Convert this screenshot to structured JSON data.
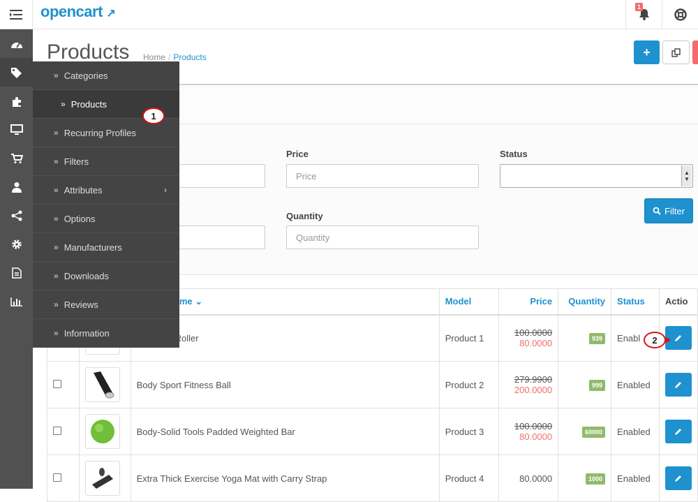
{
  "header": {
    "logo": "opencart",
    "logo_cart": "↗",
    "notification_count": "1"
  },
  "sidebar_icons": [
    "dashboard-icon",
    "tags-icon",
    "puzzle-icon",
    "desktop-icon",
    "cart-icon",
    "user-icon",
    "share-icon",
    "cog-icon",
    "report-icon",
    "chart-icon"
  ],
  "submenu": {
    "items": [
      {
        "label": "Categories"
      },
      {
        "label": "Products"
      },
      {
        "label": "Recurring Profiles"
      },
      {
        "label": "Filters"
      },
      {
        "label": "Attributes"
      },
      {
        "label": "Options"
      },
      {
        "label": "Manufacturers"
      },
      {
        "label": "Downloads"
      },
      {
        "label": "Reviews"
      },
      {
        "label": "Information"
      }
    ]
  },
  "page": {
    "title": "Products"
  },
  "breadcrumb": {
    "home": "Home",
    "sep": "/",
    "current": "Products"
  },
  "filter": {
    "price_label": "Price",
    "price_placeholder": "Price",
    "status_label": "Status",
    "quantity_label": "Quantity",
    "quantity_placeholder": "Quantity",
    "filter_button": "Filter"
  },
  "table": {
    "headers": {
      "name": "ame",
      "model": "Model",
      "price": "Price",
      "quantity": "Quantity",
      "status": "Status",
      "action": "Actio"
    },
    "rows": [
      {
        "name": "Roller",
        "model": "Product 1",
        "old_price": "100.0000",
        "special": "80.0000",
        "quantity": "939",
        "status": "Enabl"
      },
      {
        "name": "Body Sport Fitness Ball",
        "model": "Product 2",
        "old_price": "279.9900",
        "special": "200.0000",
        "quantity": "999",
        "status": "Enabled"
      },
      {
        "name": "Body-Solid Tools Padded Weighted Bar",
        "model": "Product 3",
        "old_price": "100.0000",
        "special": "80.0000",
        "quantity": "60000",
        "status": "Enabled"
      },
      {
        "name": "Extra Thick Exercise Yoga Mat with Carry Strap",
        "model": "Product 4",
        "old_price": "",
        "special": "",
        "price": "80.0000",
        "quantity": "1000",
        "status": "Enabled"
      }
    ]
  },
  "callouts": {
    "one": "1",
    "two": "2"
  },
  "colors": {
    "accent": "#1e91cf",
    "danger": "#f56b6b",
    "badge": "#8fbb6c",
    "sidebar": "#515151"
  }
}
